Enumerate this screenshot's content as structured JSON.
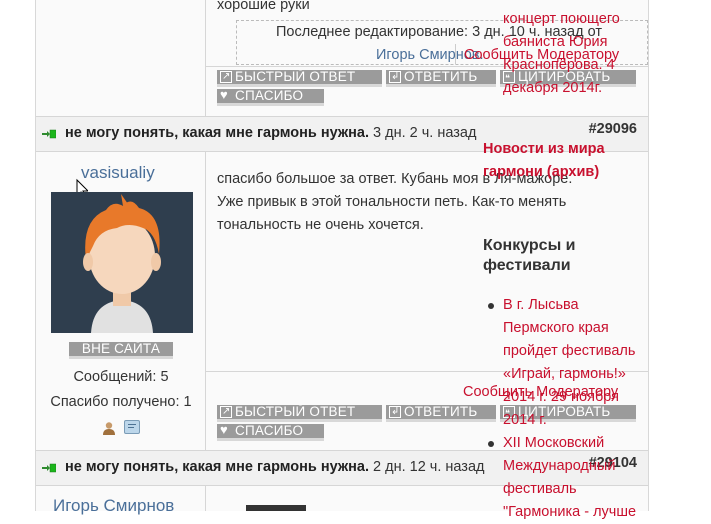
{
  "post_top": {
    "text_tail": "хорошие руки",
    "last_edit": "Последнее редактирование: 3 дн. 10 ч. назад от",
    "last_edit_user": "Игорь Смирнов.",
    "report": "Сообщить Модератору"
  },
  "buttons": {
    "quick_reply": "Быстрый ответ",
    "reply": "Ответить",
    "quote": "Цитировать",
    "thanks": "Спасибо"
  },
  "topic_rows": [
    {
      "title": "не могу понять, какая мне гармонь нужна.",
      "time": "3 дн. 2 ч. назад",
      "number": "#29096"
    },
    {
      "title": "не могу понять, какая мне гармонь нужна.",
      "time": "2 дн. 12 ч. назад",
      "number": "#29104"
    }
  ],
  "post2": {
    "username": "vasisualiy",
    "status": "Вне сайта",
    "messages": "Сообщений: 5",
    "thanks_received": "Спасибо получено: 1",
    "text": "спасибо большое за ответ. Кубань моя в Ля-мажоре. Уже привык в этой тональности петь. Как-то менять тональность не очень хочется.",
    "report": "Сообщить Модератору",
    "date_overlay": "гармонь»: 2014 г. 29 ноября 2014 г."
  },
  "post3": {
    "username": "Игорь Смирнов"
  },
  "sidebar": {
    "top_news": "концерт поющего баяниста Юрия Краснопёрова. 4 декабря 2014г.",
    "news_header": "Новости из мира гармони (архив)",
    "contests_header": "Конкурсы и фестивали",
    "item1": "В г. Лысьва Пермского края пройдет фестиваль «Играй, гармонь!» 2014 г. 29 ноября 2014 г.",
    "item2": "XII Московский Международный фестиваль \"Гармоника - лучше"
  }
}
